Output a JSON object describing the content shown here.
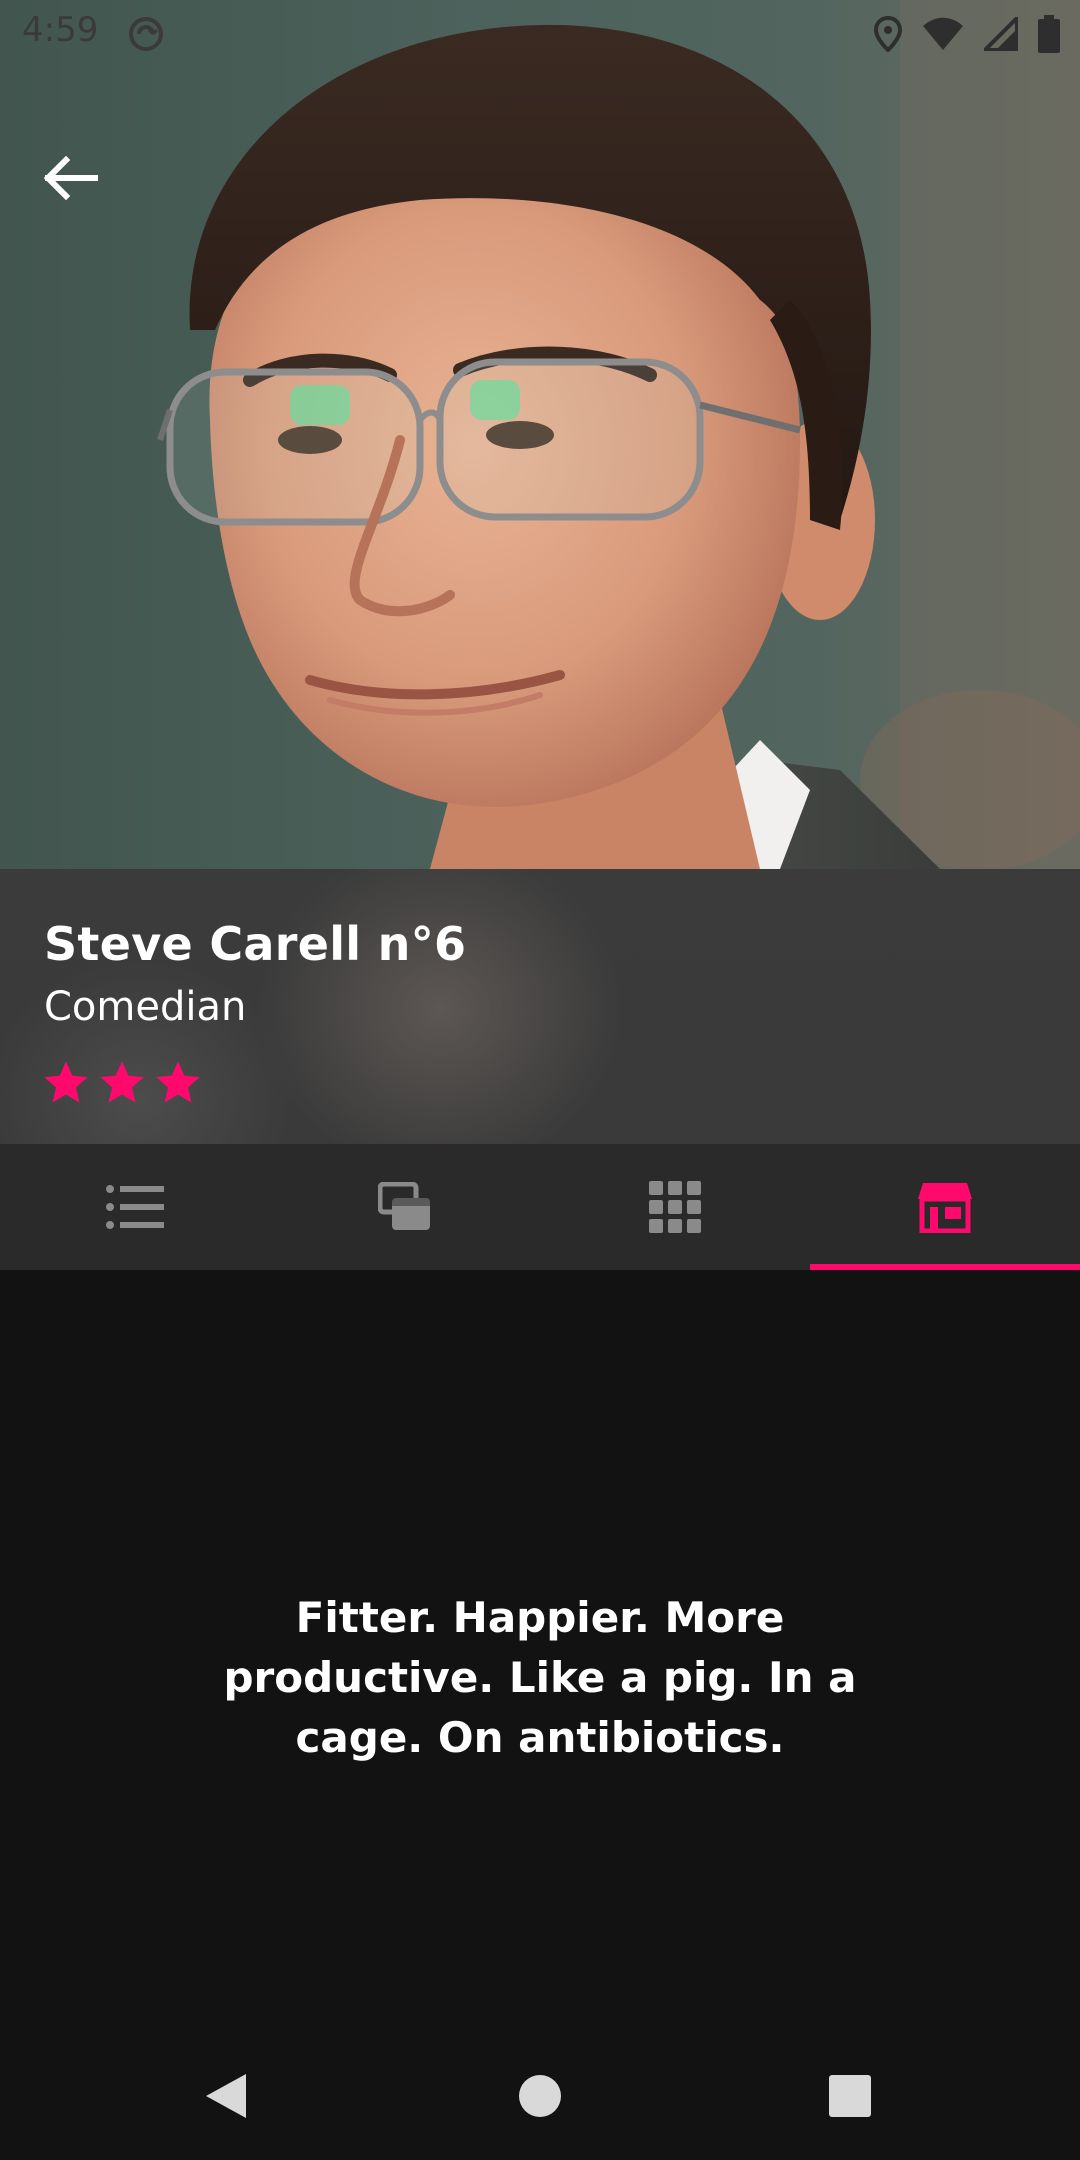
{
  "status_bar": {
    "time": "4:59",
    "icons": [
      "sync-icon",
      "location-icon",
      "wifi-icon",
      "signal-icon",
      "battery-icon"
    ]
  },
  "hero": {
    "photo": "portrait-photo"
  },
  "profile": {
    "name": "Steve Carell n°6",
    "role": "Comedian",
    "rating": 3
  },
  "tabs": [
    {
      "icon": "list-icon",
      "selected": false
    },
    {
      "icon": "cards-icon",
      "selected": false
    },
    {
      "icon": "grid-icon",
      "selected": false
    },
    {
      "icon": "store-icon",
      "selected": true
    }
  ],
  "content": {
    "quote": "Fitter. Happier. More productive. Like a pig. In a cage. On antibiotics."
  },
  "colors": {
    "accent": "#ff0a6c",
    "panel": "#3a3a3a",
    "tab_bar": "#2a2a2b",
    "background": "#121212"
  }
}
